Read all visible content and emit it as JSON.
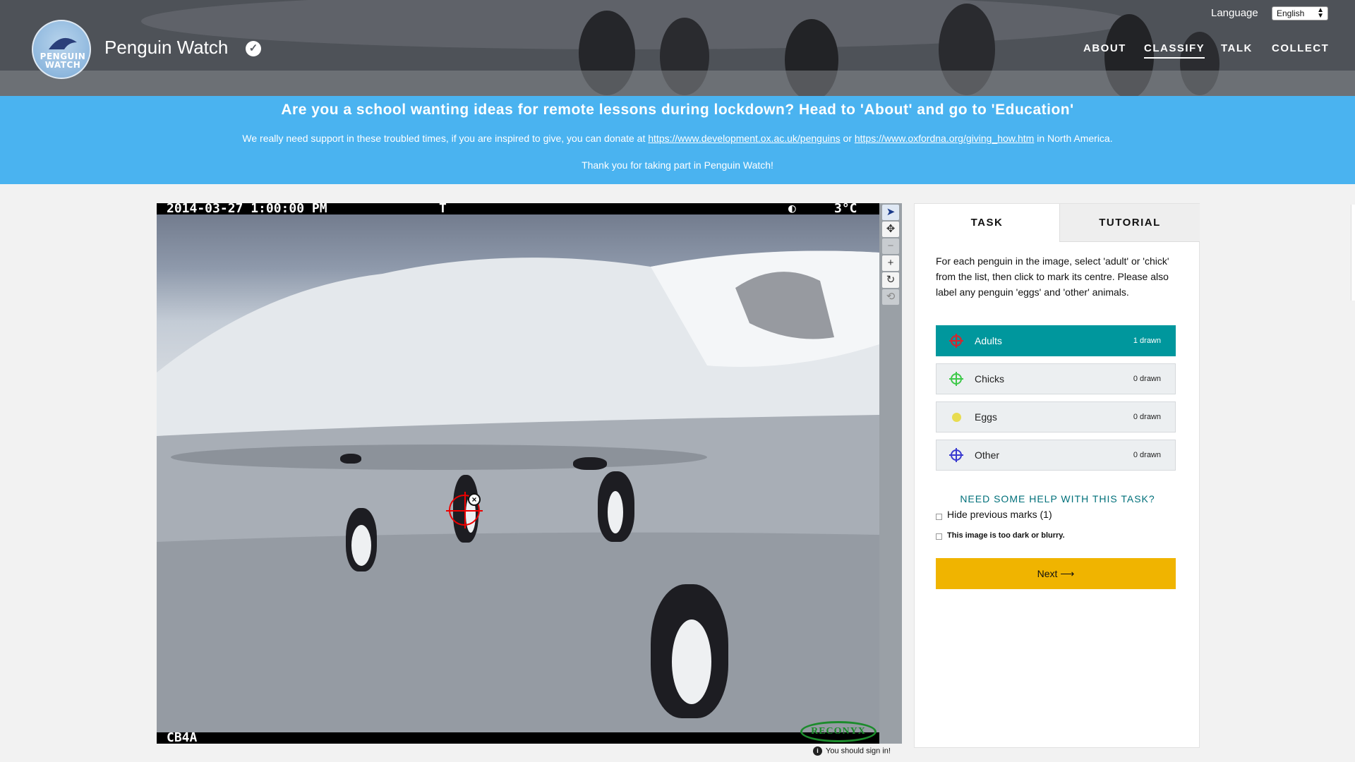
{
  "header": {
    "logo_text_1": "PENGUIN",
    "logo_text_2": "WATCH",
    "title": "Penguin Watch",
    "language_label": "Language",
    "language_value": "English",
    "nav": [
      {
        "label": "ABOUT",
        "active": false
      },
      {
        "label": "CLASSIFY",
        "active": true
      },
      {
        "label": "TALK",
        "active": false
      },
      {
        "label": "COLLECT",
        "active": false
      }
    ]
  },
  "banner": {
    "title": "Are you a school wanting ideas for remote lessons during lockdown? Head to 'About' and go to 'Education'",
    "donate_prefix": "We really need support in these troubled times, if you are inspired to give, you can donate at",
    "donate_link_1": "https://www.development.ox.ac.uk/penguins",
    "donate_or": "or",
    "donate_link_2": "https://www.oxfordna.org/giving_how.htm",
    "donate_suffix": "in North America.",
    "thanks": "Thank you for taking part in Penguin Watch!"
  },
  "viewer": {
    "datetime": "2014-03-27  1:00:00 PM",
    "cam_t": "T",
    "moon": "◐",
    "temperature": "3°C",
    "camera_id": "CB4A",
    "watermark": "RECONYX"
  },
  "toolbar": {
    "tools": [
      "pointer-icon",
      "move-icon",
      "zoom-out-icon",
      "zoom-in-icon",
      "rotate-icon",
      "reset-icon"
    ]
  },
  "signin_hint": "You should sign in!",
  "task_panel": {
    "tab_task": "TASK",
    "tab_tutorial": "TUTORIAL",
    "instructions": "For each penguin in the image, select 'adult' or 'chick' from the list, then click to mark its centre. Please also label any penguin 'eggs' and 'other' animals.",
    "tools": [
      {
        "label": "Adults",
        "count": "1 drawn",
        "color": "#d8242c",
        "selected": true
      },
      {
        "label": "Chicks",
        "count": "0 drawn",
        "color": "#3ec94a",
        "selected": false
      },
      {
        "label": "Eggs",
        "count": "0 drawn",
        "color": "#e8dc50",
        "selected": false
      },
      {
        "label": "Other",
        "count": "0 drawn",
        "color": "#3a3ad0",
        "selected": false
      }
    ],
    "help_link": "NEED SOME HELP WITH THIS TASK?",
    "hide_marks": "Hide previous marks (1)",
    "too_dark": "This image is too dark or blurry.",
    "next_label": "Next ⟶"
  },
  "colors": {
    "banner": "#4ab3f0",
    "selected_tool": "#00979d",
    "next_button": "#f0b400"
  }
}
